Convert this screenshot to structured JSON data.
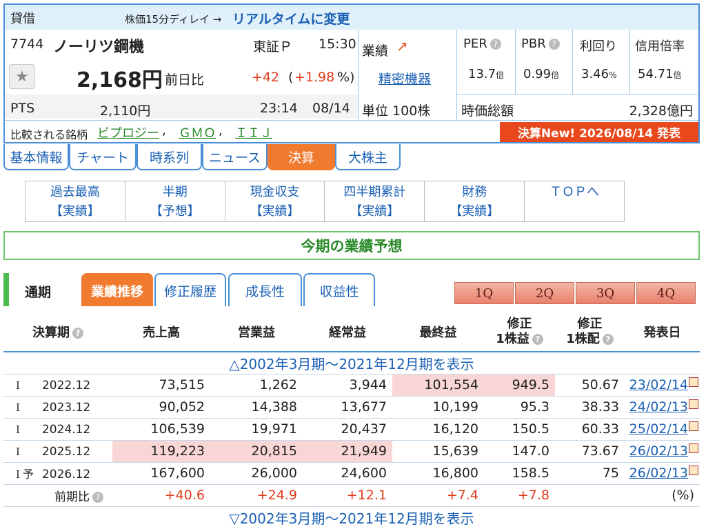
{
  "header": {
    "lending": "貸借",
    "delay_note": "株価15分ディレイ →",
    "realtime_link": "リアルタイムに変更"
  },
  "stock": {
    "code": "7744",
    "name": "ノーリツ鋼機",
    "market": "東証Ｐ",
    "time": "15:30",
    "price": "2,168円",
    "change_label": "前日比",
    "change": "+42",
    "change_pct_open": "(",
    "change_pct": "+1.98",
    "change_pct_close": "%)",
    "pts_label": "PTS",
    "pts_price": "2,110円",
    "pts_time": "23:14",
    "pts_date": "08/14",
    "performance_label": "業績",
    "industry": "精密機器",
    "unit": "単位 100株",
    "compare_label": "比較される銘柄",
    "compare": [
      "ビプロジー",
      "ＧＭＯ",
      "ＩＩＪ"
    ]
  },
  "metrics": [
    {
      "label": "PER",
      "value": "13.7",
      "unit": "倍"
    },
    {
      "label": "PBR",
      "value": "0.99",
      "unit": "倍"
    },
    {
      "label": "利回り",
      "value": "3.46",
      "unit": "%"
    },
    {
      "label": "信用倍率",
      "value": "54.71",
      "unit": "倍"
    }
  ],
  "market_cap": {
    "label": "時価総額",
    "value": "2,328億円"
  },
  "earnings_badge": "決算New! 2026/08/14 発表",
  "tabs": [
    "基本情報",
    "チャート",
    "時系列",
    "ニュース",
    "決算",
    "大株主"
  ],
  "subnav": [
    {
      "title": "過去最高",
      "sub": "【実績】"
    },
    {
      "title": "半期",
      "sub": "【予想】"
    },
    {
      "title": "現金収支",
      "sub": "【実績】"
    },
    {
      "title": "四半期累計",
      "sub": "【実績】"
    },
    {
      "title": "財務",
      "sub": "【実績】"
    },
    {
      "title": "ＴＯＰへ",
      "sub": ""
    }
  ],
  "forecast_title": "今期の業績予想",
  "period_label": "通期",
  "panel_tabs": [
    "業績推移",
    "修正履歴",
    "成長性",
    "収益性"
  ],
  "quarters": [
    "1Q",
    "2Q",
    "3Q",
    "4Q"
  ],
  "table": {
    "headers": [
      "決算期",
      "売上高",
      "営業益",
      "経常益",
      "最終益",
      "修正\n1株益",
      "修正\n1株配",
      "発表日"
    ],
    "toggle_top": "△2002年3月期～2021年12月期を表示",
    "toggle_bottom": "▽2002年3月期～2021年12月期を表示",
    "rows": [
      {
        "mark": "I",
        "pre": "",
        "period": "2022.12",
        "sales": "73,515",
        "op": "1,262",
        "ord": "3,944",
        "net": "101,554",
        "eps": "949.5",
        "div": "50.67",
        "date": "23/02/14"
      },
      {
        "mark": "I",
        "pre": "",
        "period": "2023.12",
        "sales": "90,052",
        "op": "14,388",
        "ord": "13,677",
        "net": "10,199",
        "eps": "95.3",
        "div": "38.33",
        "date": "24/02/13"
      },
      {
        "mark": "I",
        "pre": "",
        "period": "2024.12",
        "sales": "106,539",
        "op": "19,971",
        "ord": "20,437",
        "net": "16,120",
        "eps": "150.5",
        "div": "60.33",
        "date": "25/02/14"
      },
      {
        "mark": "I",
        "pre": "",
        "period": "2025.12",
        "sales": "119,223",
        "op": "20,815",
        "ord": "21,949",
        "net": "15,639",
        "eps": "147.0",
        "div": "73.67",
        "date": "26/02/13"
      },
      {
        "mark": "I",
        "pre": "予",
        "period": "2026.12",
        "sales": "167,600",
        "op": "26,000",
        "ord": "24,600",
        "net": "16,800",
        "eps": "158.5",
        "div": "75",
        "date": "26/02/13"
      }
    ],
    "yoy": {
      "label": "前期比",
      "sales": "+40.6",
      "op": "+24.9",
      "ord": "+12.1",
      "net": "+7.4",
      "eps": "+7.8",
      "unit": "(%)"
    }
  }
}
